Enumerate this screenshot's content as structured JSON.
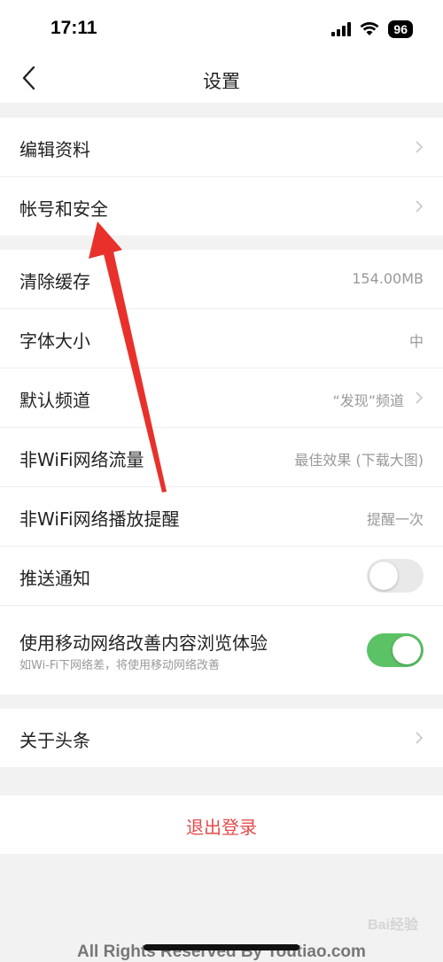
{
  "status": {
    "time": "17:11",
    "battery": "96"
  },
  "nav": {
    "title": "设置"
  },
  "group1": [
    {
      "label": "编辑资料"
    },
    {
      "label": "帐号和安全"
    }
  ],
  "group2": {
    "clear_cache": {
      "label": "清除缓存",
      "value": "154.00MB"
    },
    "font_size": {
      "label": "字体大小",
      "value": "中"
    },
    "default_channel": {
      "label": "默认频道",
      "value": "“发现”频道"
    },
    "non_wifi_traffic": {
      "label": "非WiFi网络流量",
      "value": "最佳效果 (下载大图)"
    },
    "non_wifi_play": {
      "label": "非WiFi网络播放提醒",
      "value": "提醒一次"
    },
    "push": {
      "label": "推送通知",
      "on": false
    },
    "mobile_improve": {
      "label": "使用移动网络改善内容浏览体验",
      "sub": "如Wi-Fi下网络差，将使用移动网络改善",
      "on": true
    }
  },
  "group3": [
    {
      "label": "关于头条"
    }
  ],
  "logout": {
    "label": "退出登录"
  },
  "footer": {
    "text": "All Rights Reserved By Toutiao.com"
  },
  "watermark": {
    "text": "Bai经验"
  },
  "colors": {
    "toggle_on": "#5bc266",
    "logout": "#e54b4b",
    "annotation_arrow": "#e8312b"
  }
}
